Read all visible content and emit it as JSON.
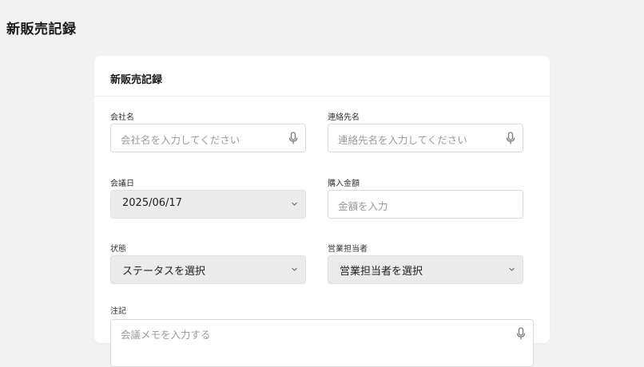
{
  "page": {
    "title": "新販売記録"
  },
  "card": {
    "title": "新販売記録"
  },
  "fields": {
    "company": {
      "label": "会社名",
      "placeholder": "会社名を入力してください"
    },
    "contact": {
      "label": "連絡先名",
      "placeholder": "連絡先名を入力してください"
    },
    "meeting_date": {
      "label": "会議日",
      "value": "2025/06/17"
    },
    "purchase_amount": {
      "label": "購入金額",
      "placeholder": "金額を入力"
    },
    "status": {
      "label": "状態",
      "value": "ステータスを選択"
    },
    "sales_rep": {
      "label": "営業担当者",
      "value": "営業担当者を選択"
    },
    "notes": {
      "label": "注記",
      "placeholder": "会議メモを入力する"
    }
  },
  "icons": {
    "mic": "microphone-icon",
    "chevron": "chevron-down-icon"
  }
}
